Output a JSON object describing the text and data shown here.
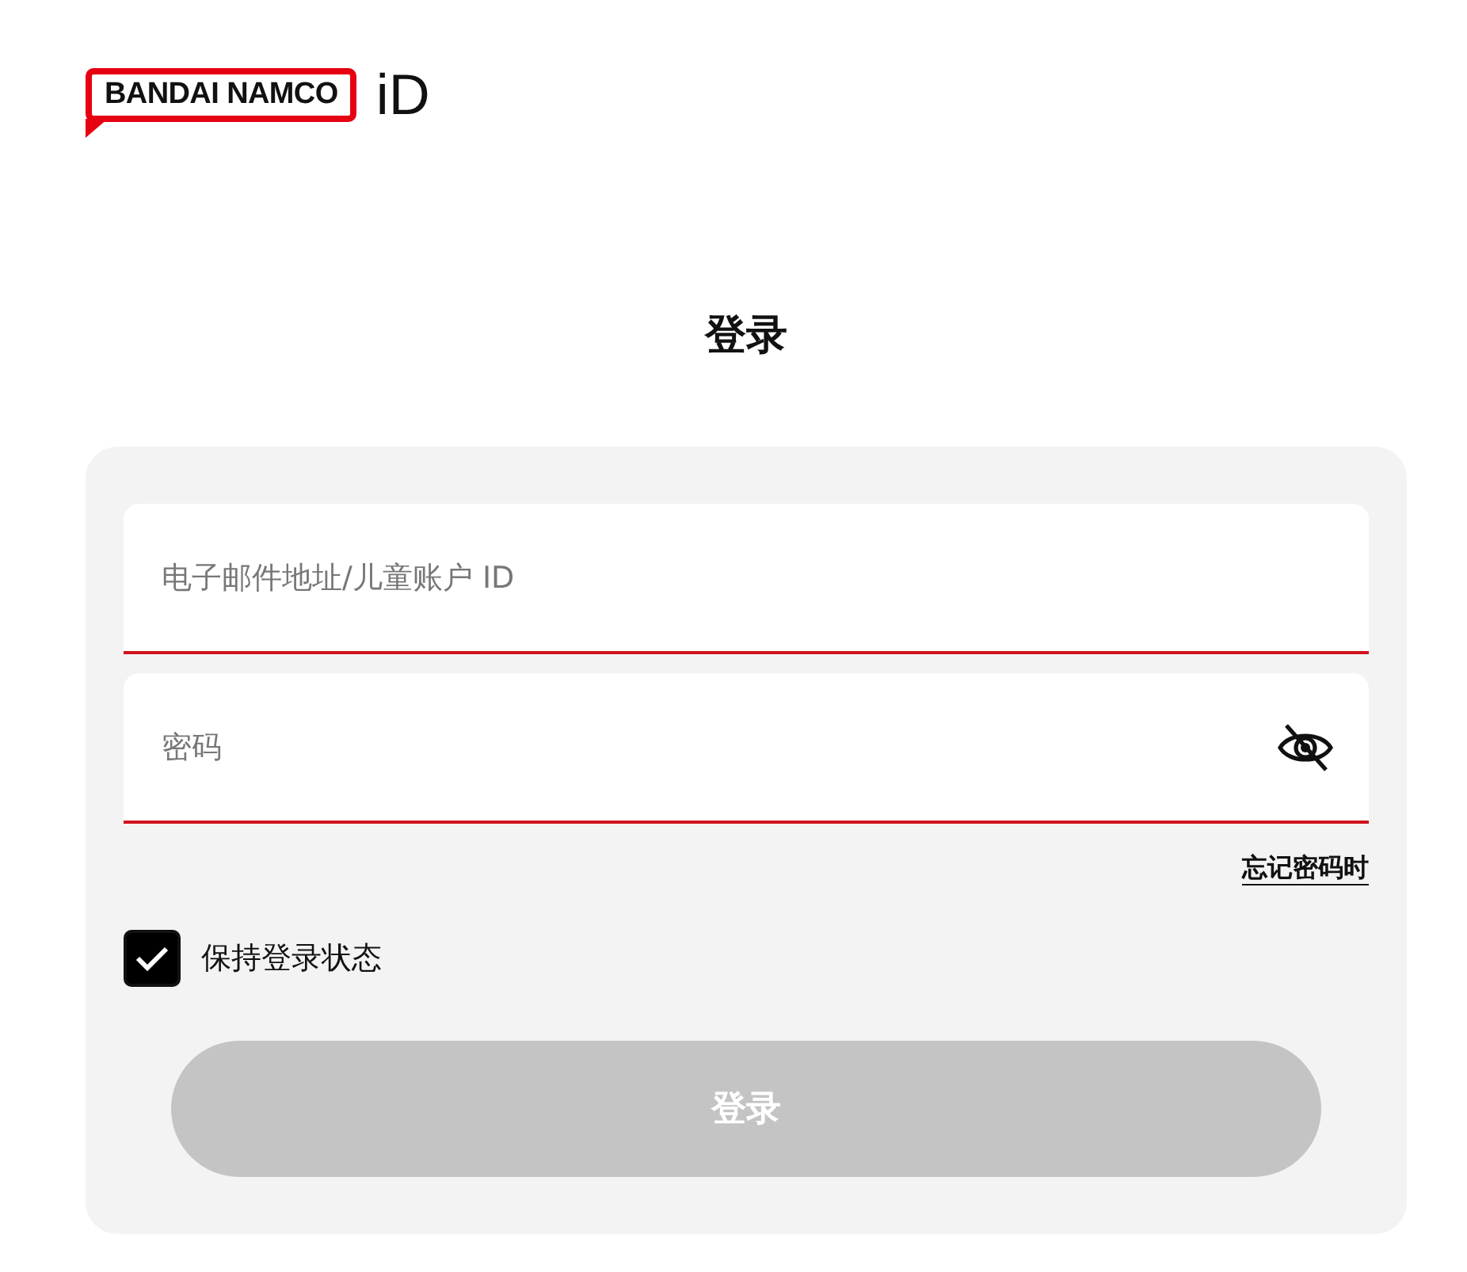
{
  "logo": {
    "brand": "BANDAI NAMCO",
    "suffix": "iD"
  },
  "title": "登录",
  "fields": [
    {
      "kind": "text",
      "placeholder": "电子邮件地址/儿童账户 ID"
    },
    {
      "kind": "password",
      "placeholder": "密码",
      "password_visible": false
    }
  ],
  "forgot_link": "忘记密码时",
  "remember": {
    "label": "保持登录状态",
    "checked": true
  },
  "submit": {
    "label": "登录",
    "disabled": true
  }
}
